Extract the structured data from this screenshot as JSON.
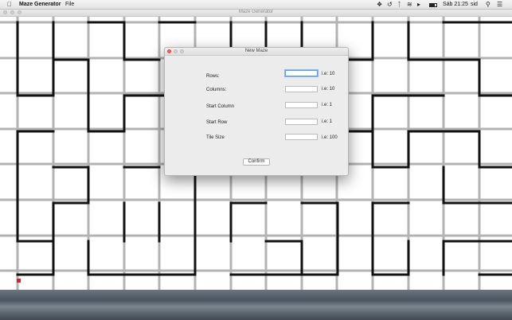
{
  "menubar": {
    "app_name": "Maze Generator",
    "file_menu": "File",
    "clock": "Sáb 21:25",
    "user": "sid"
  },
  "window": {
    "title": "Maze Generator"
  },
  "maze": {
    "start_marker_color": "#e02020"
  },
  "dialog": {
    "title": "New Maze",
    "rows_label": "Rows:",
    "rows_value": "",
    "rows_hint": "i.e: 10",
    "columns_label": "Columns:",
    "columns_value": "",
    "columns_hint": "i.e: 10",
    "start_column_label": "Start Column",
    "start_column_value": "",
    "start_column_hint": "i.e: 1",
    "start_row_label": "Start Row",
    "start_row_value": "",
    "start_row_hint": "i.e: 1",
    "tile_size_label": "Tile Size",
    "tile_size_value": "",
    "tile_size_hint": "i.e: 100",
    "confirm_label": "Confirm"
  },
  "colors": {
    "grid": "#b3b3b3",
    "path": "#111111",
    "focus": "#5a9cf4"
  }
}
